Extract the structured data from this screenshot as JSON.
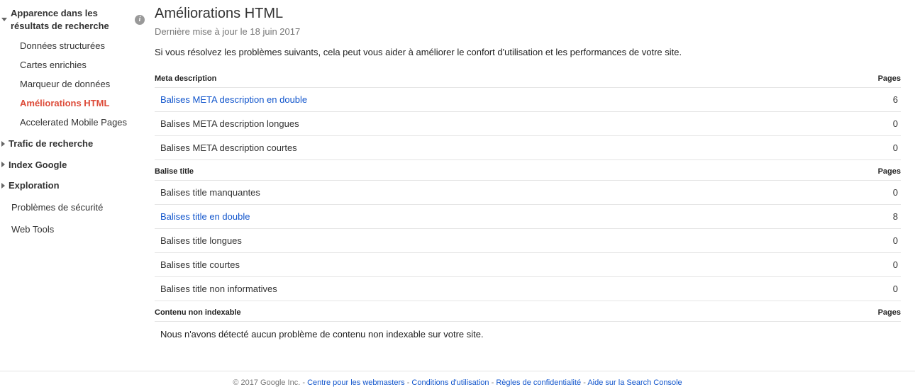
{
  "sidebar": {
    "section_expanded": {
      "title": "Apparence dans les résultats de recherche",
      "items": [
        "Données structurées",
        "Cartes enrichies",
        "Marqueur de données",
        "Améliorations HTML",
        "Accelerated Mobile Pages"
      ],
      "active_index": 3
    },
    "collapsed": [
      "Trafic de recherche",
      "Index Google",
      "Exploration"
    ],
    "singles": [
      "Problèmes de sécurité",
      "Web Tools"
    ]
  },
  "main": {
    "title": "Améliorations HTML",
    "last_updated": "Dernière mise à jour le 18 juin 2017",
    "intro": "Si vous résolvez les problèmes suivants, cela peut vous aider à améliorer le confort d'utilisation et les performances de votre site.",
    "section1": {
      "header": "Meta description",
      "pages_label": "Pages",
      "rows": [
        {
          "label": "Balises META description en double",
          "count": "6",
          "link": true
        },
        {
          "label": "Balises META description longues",
          "count": "0",
          "link": false
        },
        {
          "label": "Balises META description courtes",
          "count": "0",
          "link": false
        }
      ]
    },
    "section2": {
      "header": "Balise title",
      "pages_label": "Pages",
      "rows": [
        {
          "label": "Balises title manquantes",
          "count": "0",
          "link": false
        },
        {
          "label": "Balises title en double",
          "count": "8",
          "link": true
        },
        {
          "label": "Balises title longues",
          "count": "0",
          "link": false
        },
        {
          "label": "Balises title courtes",
          "count": "0",
          "link": false
        },
        {
          "label": "Balises title non informatives",
          "count": "0",
          "link": false
        }
      ]
    },
    "section3": {
      "header": "Contenu non indexable",
      "pages_label": "Pages",
      "note": "Nous n'avons détecté aucun problème de contenu non indexable sur votre site."
    }
  },
  "footer": {
    "copyright": "© 2017 Google Inc.",
    "links": [
      "Centre pour les webmasters",
      "Conditions d'utilisation",
      "Règles de confidentialité",
      "Aide sur la Search Console"
    ]
  }
}
